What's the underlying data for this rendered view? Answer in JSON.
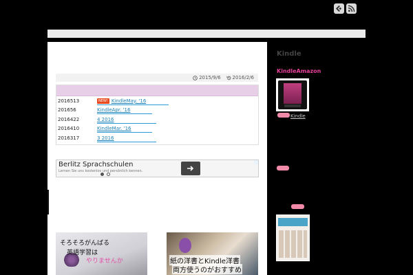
{
  "header": {
    "icons": [
      "feedly-icon",
      "rss-icon"
    ]
  },
  "article": {
    "published_date": "2015/9/6",
    "updated_date": "2016/2/6"
  },
  "news": {
    "new_badge": "NEW!",
    "rows": [
      {
        "date": "2016513",
        "title": "KindleMay. '16",
        "is_new": true
      },
      {
        "date": "201656",
        "title": "KindleApr. '16",
        "is_new": false
      },
      {
        "date": "2016422",
        "title": "4 2016",
        "is_new": false
      },
      {
        "date": "2016410",
        "title": "KindleMar. '16",
        "is_new": false
      },
      {
        "date": "2016317",
        "title": "3 2016",
        "is_new": false
      }
    ]
  },
  "ad": {
    "title": "Berlitz Sprachschulen",
    "subtitle": "Lernen Sie uns kostenlos und persönlich kennen."
  },
  "thumbnails": [
    {
      "line1": "そろそろがんばる",
      "line2": "英語学習は",
      "line3": "やりませんか"
    },
    {
      "line1": "紙の洋書とKindle洋書",
      "line2": "両方使うのがおすすめ"
    }
  ],
  "sidebar": {
    "title": "Kindle",
    "subtitle": "KindleAmazon",
    "kindle_link": "Kindle"
  },
  "colors": {
    "background": "#000000",
    "accent_pink": "#e8409a",
    "news_header": "#e8cfe8",
    "link": "#1a7fb5",
    "new_badge": "#e84b1f"
  }
}
